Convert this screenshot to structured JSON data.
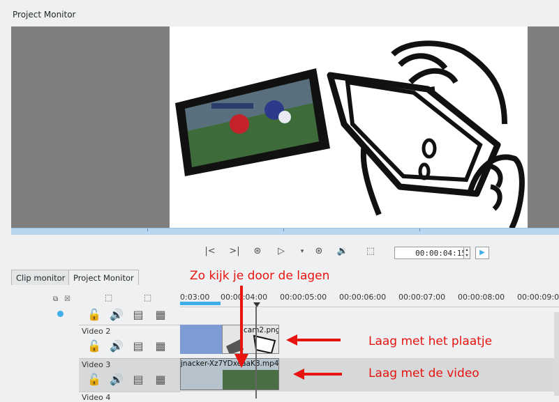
{
  "window": {
    "title": "Project Monitor"
  },
  "monitor": {
    "transport": {
      "icons": [
        "skip-to-start-icon",
        "skip-to-end-icon",
        "rewind-icon",
        "play-icon",
        "dropdown-icon",
        "forward-icon",
        "volume-icon",
        "fit-zone-icon"
      ],
      "timecode": "00:00:04:15"
    }
  },
  "tabs": [
    {
      "label": "Clip monitor",
      "active": false
    },
    {
      "label": "Project Monitor",
      "active": true
    }
  ],
  "annotations": {
    "top": "Zo kijk je door de lagen",
    "image_layer": "Laag met het plaatje",
    "video_layer": "Laag met de video"
  },
  "timeline": {
    "ruler": [
      "0:03:00",
      "00:00:04:00",
      "00:00:05:00",
      "00:00:06:00",
      "00:00:07:00",
      "00:00:08:00",
      "00:00:09:0"
    ],
    "tracks": [
      {
        "name": "",
        "clip": ""
      },
      {
        "name": "Video 2",
        "clip": "cam2.png"
      },
      {
        "name": "Video 3",
        "clip": "jnacker-Xz7YDxeaaK8.mp4"
      },
      {
        "name": "Video 4",
        "clip": ""
      }
    ]
  },
  "colors": {
    "annotation": "#e8140f",
    "accent": "#3daee9",
    "timeline_clip": "#7f9bd3"
  }
}
